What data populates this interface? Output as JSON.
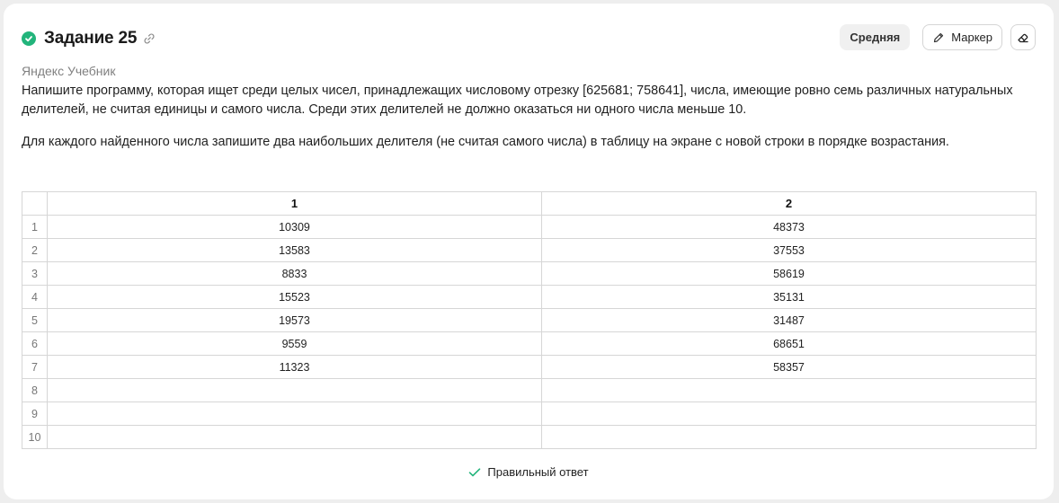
{
  "header": {
    "title": "Задание 25",
    "status_icon": "check-circle-icon",
    "link_icon": "link-icon",
    "difficulty": "Средняя",
    "marker_label": "Маркер",
    "marker_icon": "pencil-icon",
    "eraser_icon": "eraser-icon"
  },
  "task": {
    "source": "Яндекс Учебник",
    "paragraph1": "Напишите программу, которая ищет среди целых чисел, принадлежащих числовому отрезку [625681; 758641], числа, имеющие ровно семь различных натуральных делителей, не считая единицы и самого числа. Среди этих делителей не должно оказаться ни одного числа меньше 10.",
    "paragraph2": "Для каждого найденного числа запишите два наибольших делителя (не считая самого числа) в таблицу на экране с новой строки в порядке возрастания."
  },
  "table": {
    "columns": [
      "1",
      "2"
    ],
    "rows": [
      {
        "index": "1",
        "c1": "10309",
        "c2": "48373"
      },
      {
        "index": "2",
        "c1": "13583",
        "c2": "37553"
      },
      {
        "index": "3",
        "c1": "8833",
        "c2": "58619"
      },
      {
        "index": "4",
        "c1": "15523",
        "c2": "35131"
      },
      {
        "index": "5",
        "c1": "19573",
        "c2": "31487"
      },
      {
        "index": "6",
        "c1": "9559",
        "c2": "68651"
      },
      {
        "index": "7",
        "c1": "11323",
        "c2": "58357"
      },
      {
        "index": "8",
        "c1": "",
        "c2": ""
      },
      {
        "index": "9",
        "c1": "",
        "c2": ""
      },
      {
        "index": "10",
        "c1": "",
        "c2": ""
      }
    ]
  },
  "result": {
    "label": "Правильный ответ",
    "icon": "checkmark-icon",
    "color": "#22b47b"
  }
}
